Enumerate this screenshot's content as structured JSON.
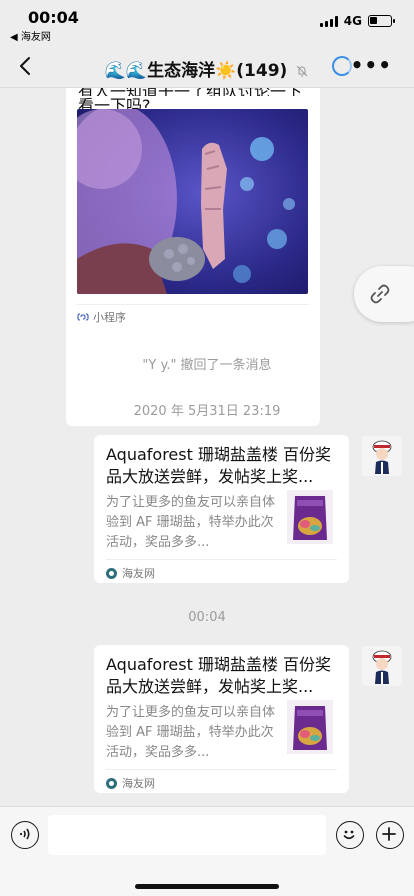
{
  "status": {
    "time": "00:04",
    "back_app": "◀ 海友网",
    "network": "4G",
    "battery_level": 0.35
  },
  "nav": {
    "title": "🌊🌊生态海洋☀️(149)",
    "more": "•••"
  },
  "messages": {
    "top_card": {
      "text_cut": "有人一知道干一了组队讨论一下吗",
      "text": "看一下吗?",
      "source": "小程序"
    },
    "recall_note": "\"Y y.\" 撤回了一条消息",
    "timestamp1": "2020 年 5月31日 23:19",
    "timestamp2": "00:04",
    "link_card_1": {
      "title": "Aquaforest 珊瑚盐盖楼 百份奖品大放送尝鲜，发帖奖上奖...",
      "desc": "为了让更多的鱼友可以亲自体验到 AF 珊瑚盐，特举办此次活动，奖品多多...",
      "source": "海友网"
    },
    "link_card_2": {
      "title": "Aquaforest 珊瑚盐盖楼 百份奖品大放送尝鲜，发帖奖上奖...",
      "desc": "为了让更多的鱼友可以亲自体验到 AF 珊瑚盐，特举办此次活动，奖品多多...",
      "source": "海友网"
    }
  },
  "input": {
    "placeholder": ""
  },
  "colors": {
    "background": "#ededed",
    "accent_loading": "#3a8ee6",
    "source_icon": "#2f6e7a"
  }
}
